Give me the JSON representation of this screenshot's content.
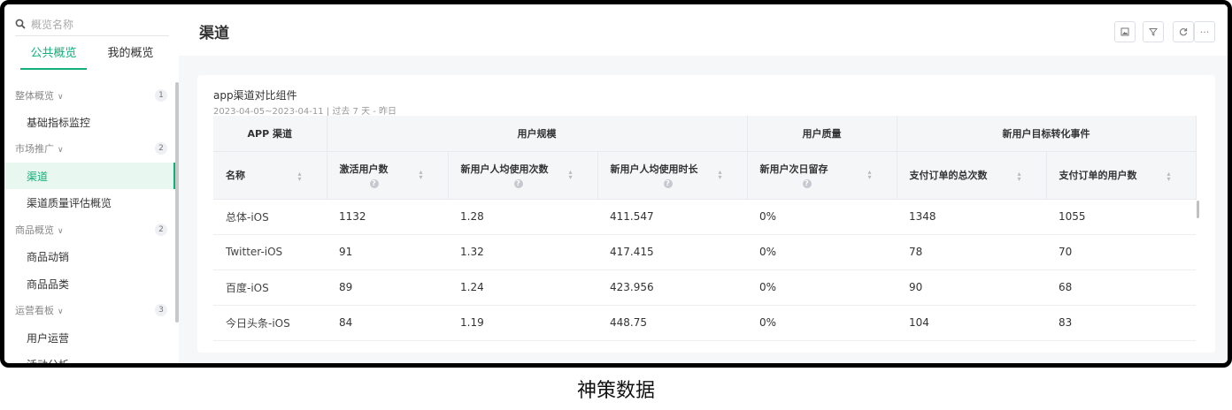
{
  "sidebar": {
    "search_placeholder": "概览名称",
    "tabs": [
      {
        "label": "公共概览"
      },
      {
        "label": "我的概览"
      }
    ],
    "groups": [
      {
        "label": "整体概览",
        "count": "1"
      },
      {
        "label": "市场推广",
        "count": "2"
      },
      {
        "label": "商品概览",
        "count": "2"
      },
      {
        "label": "运营看板",
        "count": "3"
      }
    ],
    "items": [
      {
        "label": "基础指标监控"
      },
      {
        "label": "渠道"
      },
      {
        "label": "渠道质量评估概览"
      },
      {
        "label": "商品动销"
      },
      {
        "label": "商品品类"
      },
      {
        "label": "用户运营"
      },
      {
        "label": "活动分析"
      }
    ]
  },
  "header": {
    "title": "渠道"
  },
  "toolbar": {
    "icons": [
      "image-icon",
      "filter-icon",
      "refresh-icon",
      "more-icon"
    ],
    "more_label": "···"
  },
  "card": {
    "title": "app渠道对比组件",
    "date_range": "2023-04-05~2023-04-11",
    "date_hint": "| 过去 7 天 - 昨日",
    "group_headers": [
      "APP 渠道",
      "用户规模",
      "用户质量",
      "新用户目标转化事件"
    ],
    "columns": [
      "名称",
      "激活用户数",
      "新用户人均使用次数",
      "新用户人均使用时长",
      "新用户次日留存",
      "支付订单的总次数",
      "支付订单的用户数"
    ],
    "rows": [
      [
        "总体-iOS",
        "1132",
        "1.28",
        "411.547",
        "0%",
        "1348",
        "1055"
      ],
      [
        "Twitter-iOS",
        "91",
        "1.32",
        "417.415",
        "0%",
        "78",
        "70"
      ],
      [
        "百度-iOS",
        "89",
        "1.24",
        "423.956",
        "0%",
        "90",
        "68"
      ],
      [
        "今日头条-iOS",
        "84",
        "1.19",
        "448.75",
        "0%",
        "104",
        "83"
      ]
    ]
  },
  "caption": "神策数据"
}
